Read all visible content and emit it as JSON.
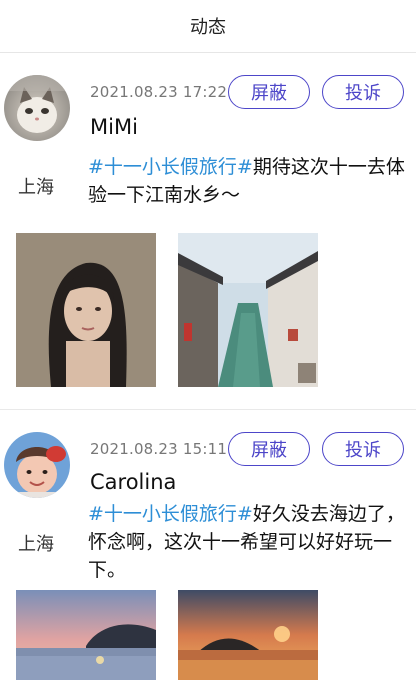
{
  "header": {
    "title": "动态"
  },
  "posts": [
    {
      "time": "2021.08.23  17:22",
      "name": "MiMi",
      "location": "上海",
      "tag": "#十一小长假旅行#",
      "text": "期待这次十一去体验一下江南水乡～",
      "block_label": "屏蔽",
      "report_label": "投诉",
      "avatar_icon": "cat-avatar",
      "photos": [
        "girl-portrait-photo",
        "water-town-canal-photo"
      ]
    },
    {
      "time": "2021.08.23  15:11",
      "name": "Carolina",
      "location": "上海",
      "tag": "#十一小长假旅行#",
      "text": "好久没去海边了，怀念啊，这次十一希望可以好好玩一下。",
      "block_label": "屏蔽",
      "report_label": "投诉",
      "avatar_icon": "child-avatar",
      "photos": [
        "sunset-island-photo",
        "sunset-sea-photo"
      ]
    }
  ],
  "colors": {
    "accent": "#4d46c9",
    "tag": "#2d8ed6"
  }
}
